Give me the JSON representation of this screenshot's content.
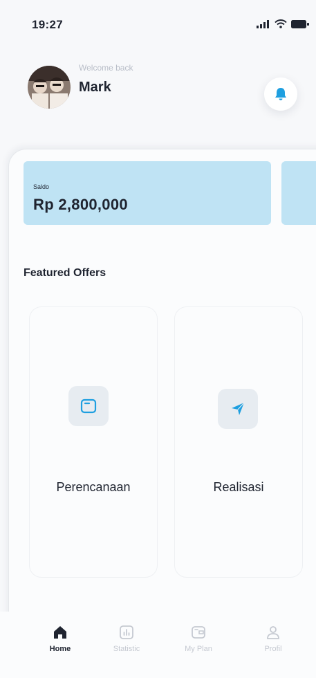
{
  "status_bar": {
    "time": "19:27",
    "icons": [
      "signal-icon",
      "wifi-icon",
      "battery-icon"
    ]
  },
  "header": {
    "welcome": "Welcome back",
    "name": "Mark",
    "avatar_icon": "user-photo-avatar",
    "notification_icon": "bell-icon"
  },
  "balance": {
    "label": "Saldo",
    "amount": "Rp 2,800,000"
  },
  "featured": {
    "title": "Featured Offers",
    "offers": [
      {
        "label": "Perencanaan",
        "icon": "wallet-icon"
      },
      {
        "label": "Realisasi",
        "icon": "send-icon"
      }
    ]
  },
  "nav": {
    "items": [
      {
        "label": "Home",
        "icon": "home-icon",
        "active": true
      },
      {
        "label": "Statistic",
        "icon": "chart-icon",
        "active": false
      },
      {
        "label": "My Plan",
        "icon": "wallet-icon",
        "active": false
      },
      {
        "label": "Profil",
        "icon": "user-icon",
        "active": false
      }
    ]
  },
  "colors": {
    "accent": "#1e9fe0",
    "card_bg": "#bfe3f4",
    "text_primary": "#1f2430",
    "text_muted": "#c5c9d1",
    "background": "#f7f8fa"
  }
}
